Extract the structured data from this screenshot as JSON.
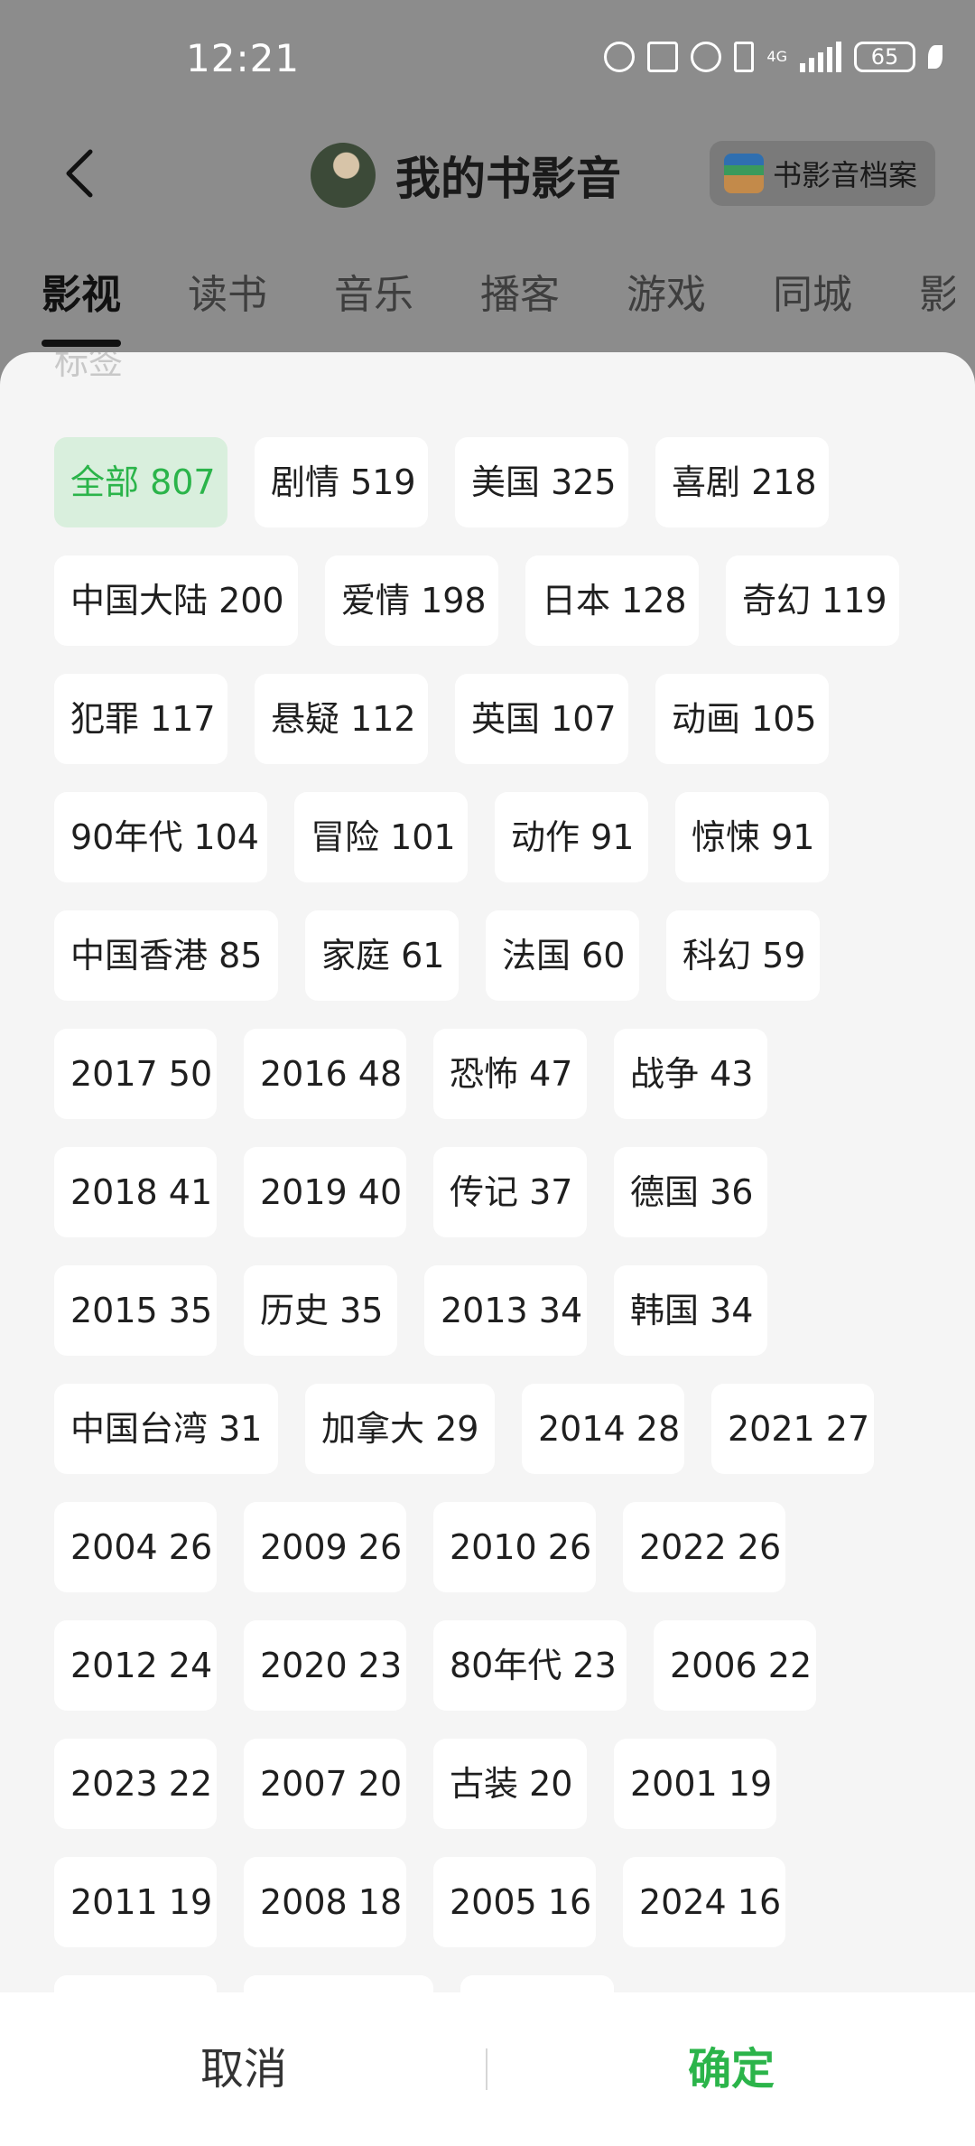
{
  "status_bar": {
    "time": "12:21",
    "network": "4G",
    "battery": "65"
  },
  "header": {
    "title": "我的书影音",
    "archive_button": "书影音档案"
  },
  "tabs": [
    "影视",
    "读书",
    "音乐",
    "播客",
    "游戏",
    "同城",
    "影"
  ],
  "sheet": {
    "title": "标签",
    "tags": [
      "全部 807",
      "剧情 519",
      "美国 325",
      "喜剧 218",
      "中国大陆 200",
      "爱情 198",
      "日本 128",
      "奇幻 119",
      "犯罪 117",
      "悬疑 112",
      "英国 107",
      "动画 105",
      "90年代 104",
      "冒险 101",
      "动作 91",
      "惊悚 91",
      "中国香港 85",
      "家庭 61",
      "法国 60",
      "科幻 59",
      "2017 50",
      "2016 48",
      "恐怖 47",
      "战争 43",
      "2018 41",
      "2019 40",
      "传记 37",
      "德国 36",
      "2015 35",
      "历史 35",
      "2013 34",
      "韩国 34",
      "中国台湾 31",
      "加拿大 29",
      "2014 28",
      "2021 27",
      "2004 26",
      "2009 26",
      "2010 26",
      "2022 26",
      "2012 24",
      "2020 23",
      "80年代 23",
      "2006 22",
      "2023 22",
      "2007 20",
      "古装 20",
      "2001 19",
      "2011 19",
      "2008 18",
      "2005 16",
      "2024 16"
    ]
  },
  "footer": {
    "cancel": "取消",
    "confirm": "确定"
  },
  "colors": {
    "accent": "#2bb44a",
    "selected_bg": "#d9efdd"
  }
}
